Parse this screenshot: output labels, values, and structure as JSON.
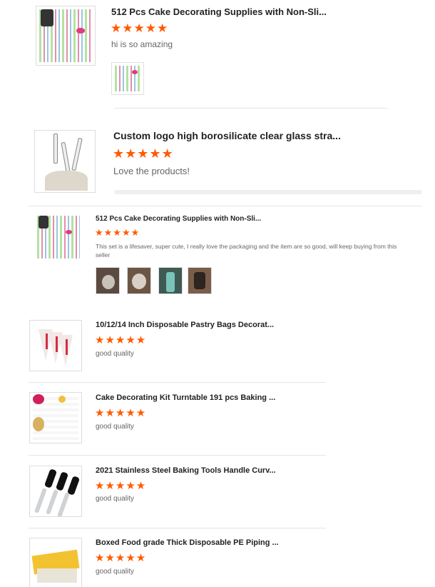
{
  "reviews": [
    {
      "title": "512 Pcs Cake Decorating Supplies with Non-Sli...",
      "rating": 5,
      "stars": "★★★★★",
      "text": "hi is so amazing"
    },
    {
      "title": "Custom logo high borosilicate clear glass stra...",
      "rating": 5,
      "stars": "★★★★★",
      "text": "Love the products!"
    },
    {
      "title": "512 Pcs Cake Decorating Supplies with Non-Sli...",
      "rating": 5,
      "stars": "★★★★★",
      "text": "This set is a lifesaver, super cute, I really love the packaging and the item are so good, will keep buying from this seller"
    },
    {
      "title": "10/12/14 Inch Disposable Pastry Bags Decorat...",
      "rating": 5,
      "stars": "★★★★★",
      "text": "good quality"
    },
    {
      "title": "Cake Decorating Kit Turntable 191 pcs Baking ...",
      "rating": 5,
      "stars": "★★★★★",
      "text": "good quality"
    },
    {
      "title": "2021 Stainless Steel Baking Tools Handle Curv...",
      "rating": 5,
      "stars": "★★★★★",
      "text": "good quality"
    },
    {
      "title": "Boxed Food grade Thick Disposable PE Piping ...",
      "rating": 5,
      "stars": "★★★★★",
      "text": "good quality"
    }
  ],
  "colors": {
    "star": "#ff5a00",
    "divider": "#e5e5e5"
  }
}
